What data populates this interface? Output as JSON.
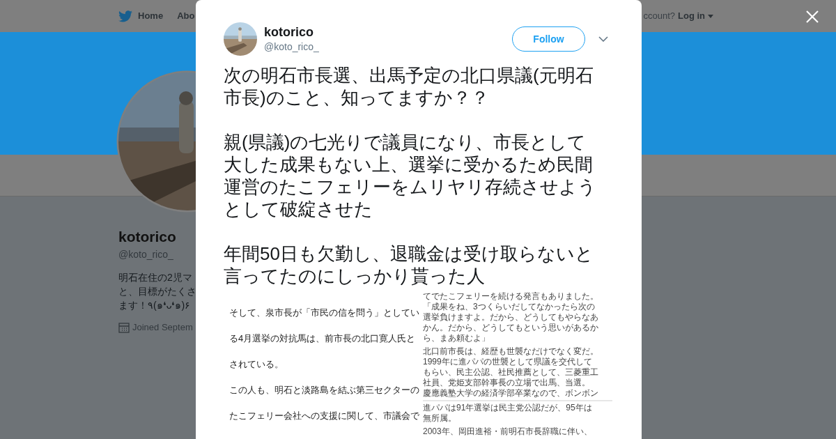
{
  "nav": {
    "items": [
      {
        "label": "Home",
        "selected": false
      },
      {
        "label": "Abo",
        "selected": false
      }
    ],
    "account_prompt": "ccount?",
    "login": "Log in"
  },
  "profile": {
    "name": "kotorico",
    "handle": "@koto_rico_",
    "bio": [
      "明石在住の2児マ",
      "と、目標がたくさ",
      "ます！٩(๑❛ᴗ❛๑)۶"
    ],
    "joined": "Joined Septem"
  },
  "tweet": {
    "name": "kotorico",
    "handle": "@koto_rico_",
    "follow": "Follow",
    "paragraphs": [
      "次の明石市長選、出馬予定の北口県議(元明石市長)のこと、知ってますか？？",
      "親(県議)の七光りで議員になり、市長として大した成果もない上、選挙に受かるため民間運営のたこフェリーをムリヤリ存続させようとして破綻させた",
      "年間50日も欠勤し、退職金は受け取らないと言ってたのにしっかり貰った人"
    ],
    "attachment": {
      "left_lines": [
        "そして、泉市長が「市民の信を問う」としてい",
        "る4月選挙の対抗馬は、前市長の北口寛人氏と",
        "されている。",
        "この人も、明石と淡路島を結ぶ第三セクターの",
        "たこフェリー会社への支援に関して、市議会で"
      ],
      "right_blocks": [
        {
          "lines": [
            "てでたこフェリーを続ける発言もありました。",
            "「成果をね、3つくらいだしてなかったら次の",
            "選挙負けますよ。だから、どうしてもやらなあ",
            "かん。だから、どうしてもという思いがあるか",
            "ら、まあ頼むよ」"
          ]
        },
        {
          "lines": [
            "北口前市長は、経歴も世襲なだけでなく変だ。",
            "1999年に進パパの世襲として県議を交代して",
            "もらい、民主公認、社民推薦として、三菱重工",
            "社員、党姫支部幹事長の立場で出馬、当選。",
            "慶應義塾大学の経済学部卒業なので、ボンボン"
          ],
          "divider_after": true
        },
        {
          "lines": [
            "進パパは91年選挙は民主党公認だが、95年は",
            "無所属。"
          ]
        },
        {
          "lines": [
            "2003年、岡田進裕・前明石市長辞職に伴い、"
          ]
        }
      ]
    }
  }
}
